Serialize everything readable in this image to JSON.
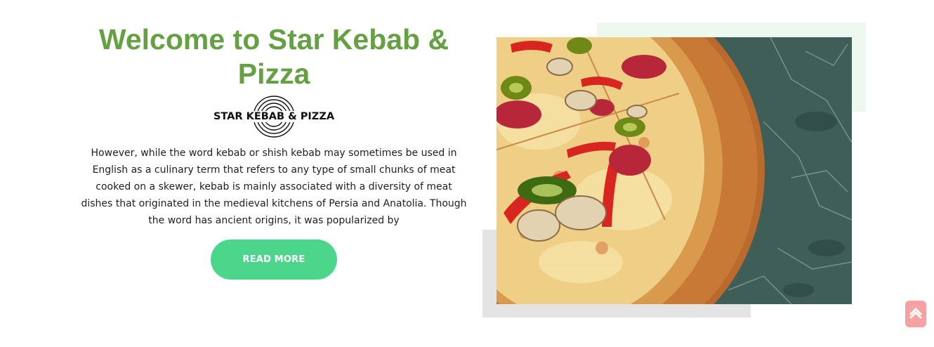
{
  "hero": {
    "title": "Welcome to Star Kebab & Pizza",
    "logo_text": "STAR KEBAB & PIZZA",
    "description": "However, while the word kebab or shish kebab may sometimes be used in English as a culinary term that refers to any type of small chunks of meat cooked on a skewer, kebab is mainly associated with a diversity of meat dishes that originated in the medieval kitchens of Persia and Anatolia. Though the word has ancient origins, it was popularized by",
    "read_more_label": "READ MORE"
  },
  "image": {
    "subject": "pizza-on-wooden-board"
  },
  "scroll_top": {
    "icon": "chevron-up-icon"
  },
  "colors": {
    "title": "#65a043",
    "button": "#4bd68b",
    "scroll_button": "#f6a2a5",
    "accent_green_block": "#edf9ef",
    "accent_gray_block": "#e4e4e4"
  }
}
